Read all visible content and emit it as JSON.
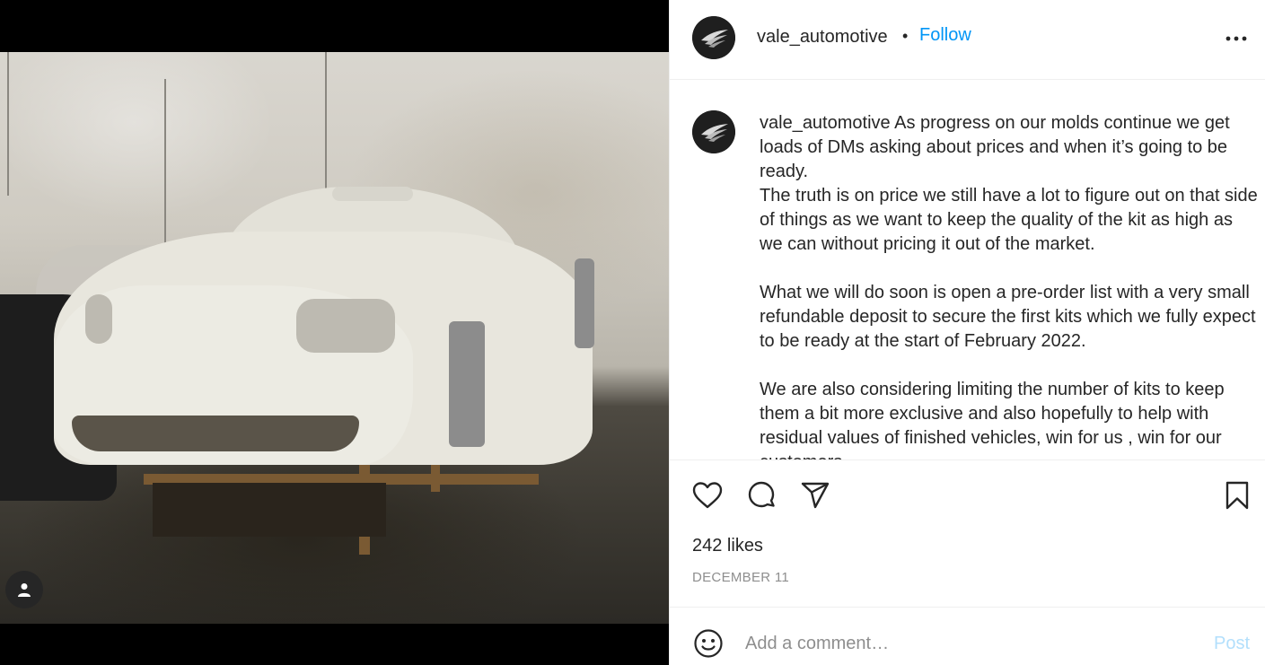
{
  "post": {
    "username": "vale_automotive",
    "separator": "•",
    "follow_label": "Follow",
    "caption": "As progress on our molds continue we get loads of DMs asking about prices and when it’s going to be ready.\nThe truth is on price we still have a lot to figure out on that side of things as we want to keep the quality of the kit as high as we can without pricing it out of the market.\n\nWhat we will do soon is open a pre-order list with a very small refundable deposit to secure the first kits which we fully expect to be ready at the start of February 2022.\n\nWe are also considering limiting the number of kits to keep them a bit more exclusive and also hopefully to help with residual values of finished vehicles, win for us , win for our customers.",
    "likes": "242 likes",
    "date": "DECEMBER 11"
  },
  "comment": {
    "placeholder": "Add a comment…",
    "post_label": "Post"
  },
  "icons": {
    "more": "more-options-icon",
    "like": "heart-icon",
    "comment": "comment-bubble-icon",
    "share": "paper-plane-icon",
    "save": "bookmark-icon",
    "emoji": "emoji-smile-icon",
    "user_tag": "user-tag-icon"
  },
  "colors": {
    "link_blue": "#0095f6",
    "post_disabled": "#b2dffc",
    "muted": "#8e8e8e",
    "text": "#262626"
  }
}
